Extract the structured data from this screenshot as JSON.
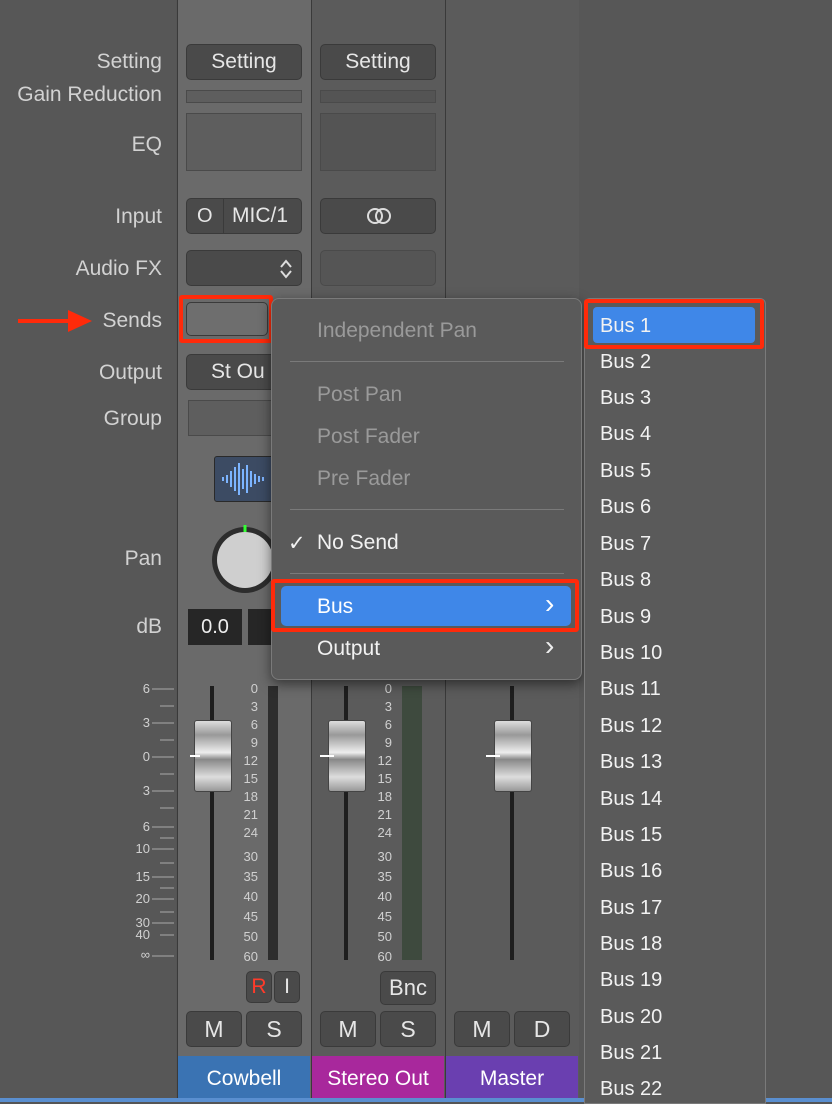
{
  "labels": {
    "setting": "Setting",
    "gain_reduction": "Gain Reduction",
    "eq": "EQ",
    "input": "Input",
    "audio_fx": "Audio FX",
    "sends": "Sends",
    "output": "Output",
    "group": "Group",
    "pan": "Pan",
    "db": "dB"
  },
  "strips": {
    "cowbell": {
      "setting": "Setting",
      "input_circle": "O",
      "input": "MIC/1",
      "output": "St Ou",
      "db": "0.0",
      "rec": "R",
      "input_mon": "I",
      "mute": "M",
      "solo": "S",
      "name": "Cowbell"
    },
    "stereo_out": {
      "setting": "Setting",
      "bnc": "Bnc",
      "mute": "M",
      "solo": "S",
      "name": "Stereo Out"
    },
    "master": {
      "mute": "M",
      "dim": "D",
      "name": "Master"
    }
  },
  "left_scale": [
    "6",
    "3",
    "0",
    "3",
    "6",
    "10",
    "15",
    "20",
    "30",
    "40",
    "∞"
  ],
  "meter_scale": [
    "0",
    "3",
    "6",
    "9",
    "12",
    "15",
    "18",
    "21",
    "24",
    "30",
    "35",
    "40",
    "45",
    "50",
    "60"
  ],
  "send_menu": {
    "independent_pan": "Independent Pan",
    "post_pan": "Post Pan",
    "post_fader": "Post Fader",
    "pre_fader": "Pre Fader",
    "checkmark": "✓",
    "no_send": "No Send",
    "bus": "Bus",
    "output": "Output",
    "chevron": "›"
  },
  "bus_list": [
    "Bus 1",
    "Bus 2",
    "Bus 3",
    "Bus 4",
    "Bus 5",
    "Bus 6",
    "Bus 7",
    "Bus 8",
    "Bus 9",
    "Bus 10",
    "Bus 11",
    "Bus 12",
    "Bus 13",
    "Bus 14",
    "Bus 15",
    "Bus 16",
    "Bus 17",
    "Bus 18",
    "Bus 19",
    "Bus 20",
    "Bus 21",
    "Bus 22"
  ],
  "colors": {
    "highlight": "#3f87e8",
    "annotation": "#ff2a0a",
    "cowbell_tag": "#3a73b3",
    "stereo_out_tag": "#a8289c",
    "master_tag": "#6a3fb0"
  }
}
